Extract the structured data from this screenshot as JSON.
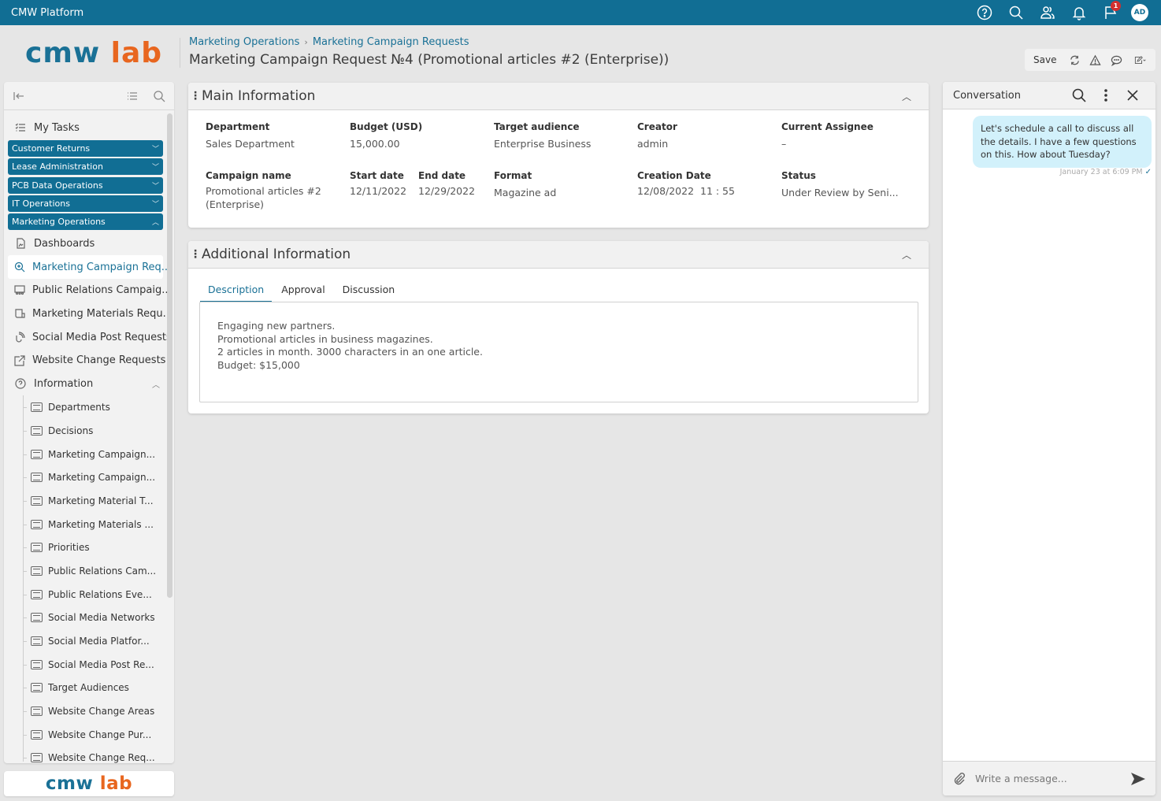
{
  "app": {
    "title": "CMW Platform",
    "notifications_badge": "1",
    "user_initials": "AD",
    "brand_color": "#116e94",
    "accent_color": "#e8661f"
  },
  "topbar_icons": [
    "help-icon",
    "search-icon",
    "users-icon",
    "bell-icon",
    "flag-icon"
  ],
  "logo": {
    "part1": "cmw",
    "part2": "lab"
  },
  "breadcrumb": {
    "items": [
      "Marketing Operations",
      "Marketing Campaign Requests"
    ],
    "separator": ">"
  },
  "page_title": "Marketing Campaign Request №4 (Promotional articles #2 (Enterprise))",
  "toolbar": {
    "save_label": "Save"
  },
  "sidebar": {
    "my_tasks": "My Tasks",
    "groups": [
      {
        "label": "Customer Returns",
        "expanded": false
      },
      {
        "label": "Lease Administration",
        "expanded": false
      },
      {
        "label": "PCB Data Operations",
        "expanded": false
      },
      {
        "label": "IT Operations",
        "expanded": false
      },
      {
        "label": "Marketing Operations",
        "expanded": true
      }
    ],
    "items": [
      {
        "label": "Dashboards",
        "icon": "dashboard-icon"
      },
      {
        "label": "Marketing Campaign Req...",
        "icon": "zoom-search-icon",
        "active": true
      },
      {
        "label": "Public Relations Campaig...",
        "icon": "audience-icon"
      },
      {
        "label": "Marketing Materials Requ...",
        "icon": "scroll-icon"
      },
      {
        "label": "Social Media Post Requests",
        "icon": "broadcast-icon"
      },
      {
        "label": "Website Change Requests",
        "icon": "external-link-icon"
      },
      {
        "label": "Information",
        "icon": "help-circle-icon",
        "expanded": true
      }
    ],
    "sub_items": [
      "Departments",
      "Decisions",
      "Marketing Campaign...",
      "Marketing Campaign...",
      "Marketing Material T...",
      "Marketing Materials ...",
      "Priorities",
      "Public Relations Cam...",
      "Public Relations Eve...",
      "Social Media Networks",
      "Social Media Platfor...",
      "Social Media Post Re...",
      "Target Audiences",
      "Website Change Areas",
      "Website Change Pur...",
      "Website Change Req..."
    ]
  },
  "main_info": {
    "title": "Main Information",
    "fields": {
      "department": {
        "label": "Department",
        "value": "Sales Department"
      },
      "budget": {
        "label": "Budget (USD)",
        "value": "15,000.00"
      },
      "target_audience": {
        "label": "Target audience",
        "value": "Enterprise Business"
      },
      "creator": {
        "label": "Creator",
        "value": "admin"
      },
      "current_assignee": {
        "label": "Current Assignee",
        "value": "–"
      },
      "campaign_name": {
        "label": "Campaign name",
        "value": "Promotional articles #2 (Enterprise)"
      },
      "start_date": {
        "label": "Start date",
        "value": "12/11/2022"
      },
      "end_date": {
        "label": "End date",
        "value": "12/29/2022"
      },
      "format": {
        "label": "Format",
        "value": "Magazine ad"
      },
      "creation_date": {
        "label": "Creation Date",
        "value": "12/08/2022  11 : 55"
      },
      "status": {
        "label": "Status",
        "value": "Under Review by Seni..."
      }
    }
  },
  "additional_info": {
    "title": "Additional Information",
    "tabs": [
      {
        "label": "Description",
        "active": true
      },
      {
        "label": "Approval",
        "active": false
      },
      {
        "label": "Discussion",
        "active": false
      }
    ],
    "description_lines": [
      "Engaging new partners.",
      "Promotional articles in business magazines.",
      "2 articles in month. 3000 characters in an one article.",
      "Budget: $15,000"
    ]
  },
  "conversation": {
    "title": "Conversation",
    "messages": [
      {
        "text": "Let's schedule a call to discuss all the details. I have a few questions on this. How about Tuesday?",
        "time": "January 23 at 6:09 PM",
        "read": true
      }
    ],
    "input_placeholder": "Write a message..."
  }
}
